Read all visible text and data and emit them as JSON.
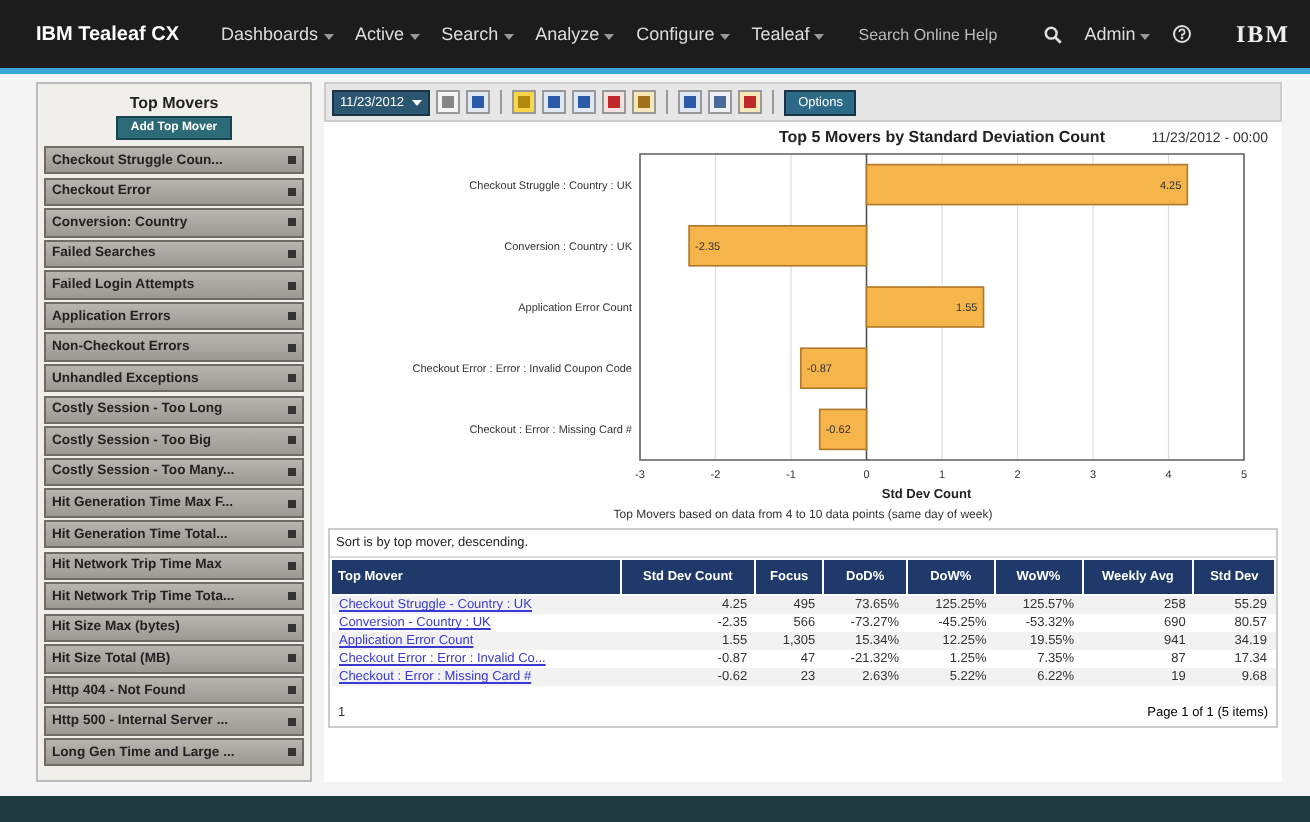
{
  "nav": {
    "brand": "IBM Tealeaf CX",
    "menus": [
      "Dashboards",
      "Active",
      "Search",
      "Analyze",
      "Configure",
      "Tealeaf"
    ],
    "search": {
      "placeholder": "Search Online Help"
    },
    "user": "Admin",
    "logo": "IBM"
  },
  "sidebar": {
    "title": "Top Movers",
    "add_button": "Add Top Mover",
    "items": [
      {
        "label": "Checkout Struggle Coun..."
      },
      {
        "label": "Checkout Error"
      },
      {
        "label": "Conversion: Country"
      },
      {
        "label": "Failed Searches"
      },
      {
        "label": "Failed Login Attempts"
      },
      {
        "label": "Application Errors"
      },
      {
        "label": "Non-Checkout Errors"
      },
      {
        "label": "Unhandled Exceptions"
      },
      {
        "label": "Costly Session - Too Long"
      },
      {
        "label": "Costly Session - Too Big"
      },
      {
        "label": "Costly Session - Too Many..."
      },
      {
        "label": "Hit Generation Time Max F..."
      },
      {
        "label": "Hit Generation Time Total..."
      },
      {
        "label": "Hit Network Trip Time Max"
      },
      {
        "label": "Hit Network Trip Time Tota..."
      },
      {
        "label": "Hit Size Max (bytes)"
      },
      {
        "label": "Hit Size Total (MB)"
      },
      {
        "label": "Http 404 - Not Found"
      },
      {
        "label": "Http 500 - Internal Server ..."
      },
      {
        "label": "Long Gen Time and Large ..."
      }
    ]
  },
  "toolbar": {
    "date": "11/23/2012",
    "options_button": "Options"
  },
  "chart": {
    "date": "11/23/2012 - 00:00",
    "caption": "Top Movers based on data from 4 to 10 data points (same day of week)",
    "chart_data": {
      "type": "bar",
      "orientation": "horizontal",
      "title": "Top 5 Movers by Standard Deviation Count",
      "xlabel": "Std Dev Count",
      "categories": [
        "Checkout Struggle : Country : UK",
        "Conversion : Country : UK",
        "Application Error Count",
        "Checkout Error : Error : Invalid Coupon Code",
        "Checkout : Error : Missing Card #"
      ],
      "series": [
        {
          "color": "#f5b54a",
          "values": [
            4.25,
            -2.35,
            1.55,
            -0.87,
            -0.62
          ]
        }
      ],
      "xlim": [
        -3,
        5
      ],
      "xticks": [
        -3,
        -2,
        -1,
        0,
        1,
        2,
        3,
        4,
        5
      ],
      "data_labels": true,
      "grid": true
    }
  },
  "table": {
    "note": "Sort is by top mover, descending.",
    "columns": [
      "Top Mover",
      "Std Dev Count",
      "Focus",
      "DoD%",
      "DoW%",
      "WoW%",
      "Weekly Avg",
      "Std Dev"
    ],
    "rows": [
      [
        "Checkout Struggle - Country : UK",
        "4.25",
        "495",
        "73.65%",
        "125.25%",
        "125.57%",
        "258",
        "55.29"
      ],
      [
        "Conversion - Country : UK",
        "-2.35",
        "566",
        "-73.27%",
        "-45.25%",
        "-53.32%",
        "690",
        "80.57"
      ],
      [
        "Application Error Count",
        "1.55",
        "1,305",
        "15.34%",
        "12.25%",
        "19.55%",
        "941",
        "34.19"
      ],
      [
        "Checkout Error : Error : Invalid Co...",
        "-0.87",
        "47",
        "-21.32%",
        "1.25%",
        "7.35%",
        "87",
        "17.34"
      ],
      [
        "Checkout : Error : Missing Card #",
        "-0.62",
        "23",
        "2.63%",
        "5.22%",
        "6.22%",
        "19",
        "9.68"
      ]
    ],
    "pager": "1",
    "page_info": "Page 1 of 1 (5 items)"
  }
}
